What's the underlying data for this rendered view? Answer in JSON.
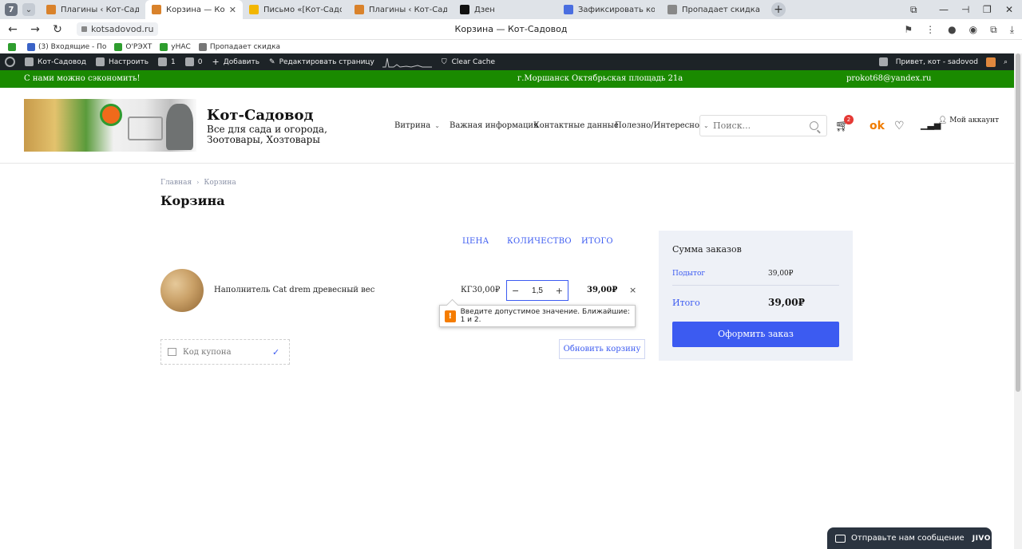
{
  "browser": {
    "tab_count": "7",
    "tabs": [
      {
        "title": "Плагины ‹ Кот-Садовод —",
        "color": "#d9822b"
      },
      {
        "title": "Корзина — Кот-Садовод",
        "color": "#d9822b",
        "active": true
      },
      {
        "title": "Письмо «[Кот-Садовод]: ",
        "color": "#f2b600"
      },
      {
        "title": "Плагины ‹ Кот-Садовод —",
        "color": "#d9822b"
      },
      {
        "title": "Дзен",
        "color": "#111111"
      },
      {
        "title": "Зафиксировать корзину",
        "color": "#4a6ee0"
      },
      {
        "title": "Пропадает скидка | Word",
        "color": "#888888"
      }
    ],
    "url": "kotsadovod.ru",
    "page_title": "Корзина — Кот-Садовод",
    "bookmarks": [
      {
        "label": "",
        "color": "#2e9d2e"
      },
      {
        "label": "(3) Входящие - По",
        "color": "#3a63c7"
      },
      {
        "label": "О'РЭХТ",
        "color": "#2e9d2e"
      },
      {
        "label": "уНАС",
        "color": "#2e9d2e"
      },
      {
        "label": "Пропадает скидка",
        "color": "#777777"
      }
    ]
  },
  "wpadmin": {
    "site_name": "Кот-Садовод",
    "customize": "Настроить",
    "updates": "1",
    "comments": "0",
    "add_new": "Добавить",
    "edit_page": "Редактировать страницу",
    "clear_cache": "Clear Cache",
    "greeting": "Привет, кот - sadovod"
  },
  "topbar": {
    "left": "С нами можно сэкономить!",
    "center": "г.Моршанск Октябрьская площадь 21а",
    "right": "prokot68@yandex.ru"
  },
  "header": {
    "site_title": "Кот-Садовод",
    "site_description": "Все для сада и огорода, Зоотовары, Хозтовары",
    "nav": [
      "Витрина",
      "Важная информация",
      "Контактные данные",
      "Полезно/Интересно"
    ],
    "search_placeholder": "Поиск...",
    "cart_count": "2",
    "account": "Мой аккаунт"
  },
  "page": {
    "breadcrumb": [
      "Главная",
      "Корзина"
    ],
    "title": "Корзина"
  },
  "cart": {
    "columns": {
      "price": "ЦЕНА",
      "quantity": "КОЛИЧЕСТВО",
      "total": "ИТОГО"
    },
    "items": [
      {
        "name": "Наполнитель Cat drem древесный вес",
        "price": "КГ30,00₽",
        "quantity": "1,5",
        "total": "39,00₽"
      }
    ],
    "validation_tooltip": "Введите допустимое значение. Ближайшие: 1 и 2.",
    "coupon_placeholder": "Код купона",
    "update_button": "Обновить корзину"
  },
  "summary": {
    "heading": "Сумма заказов",
    "subtotal_label": "Подытог",
    "subtotal_value": "39,00₽",
    "total_label": "Итого",
    "total_value": "39,00₽",
    "checkout_button": "Оформить заказ"
  },
  "chat": {
    "label": "Отправьте нам сообщение",
    "brand": "JIVO"
  },
  "colors": {
    "accent": "#3c5bf1",
    "topbar_green": "#1a8a00",
    "wp_bar": "#1d2327"
  }
}
